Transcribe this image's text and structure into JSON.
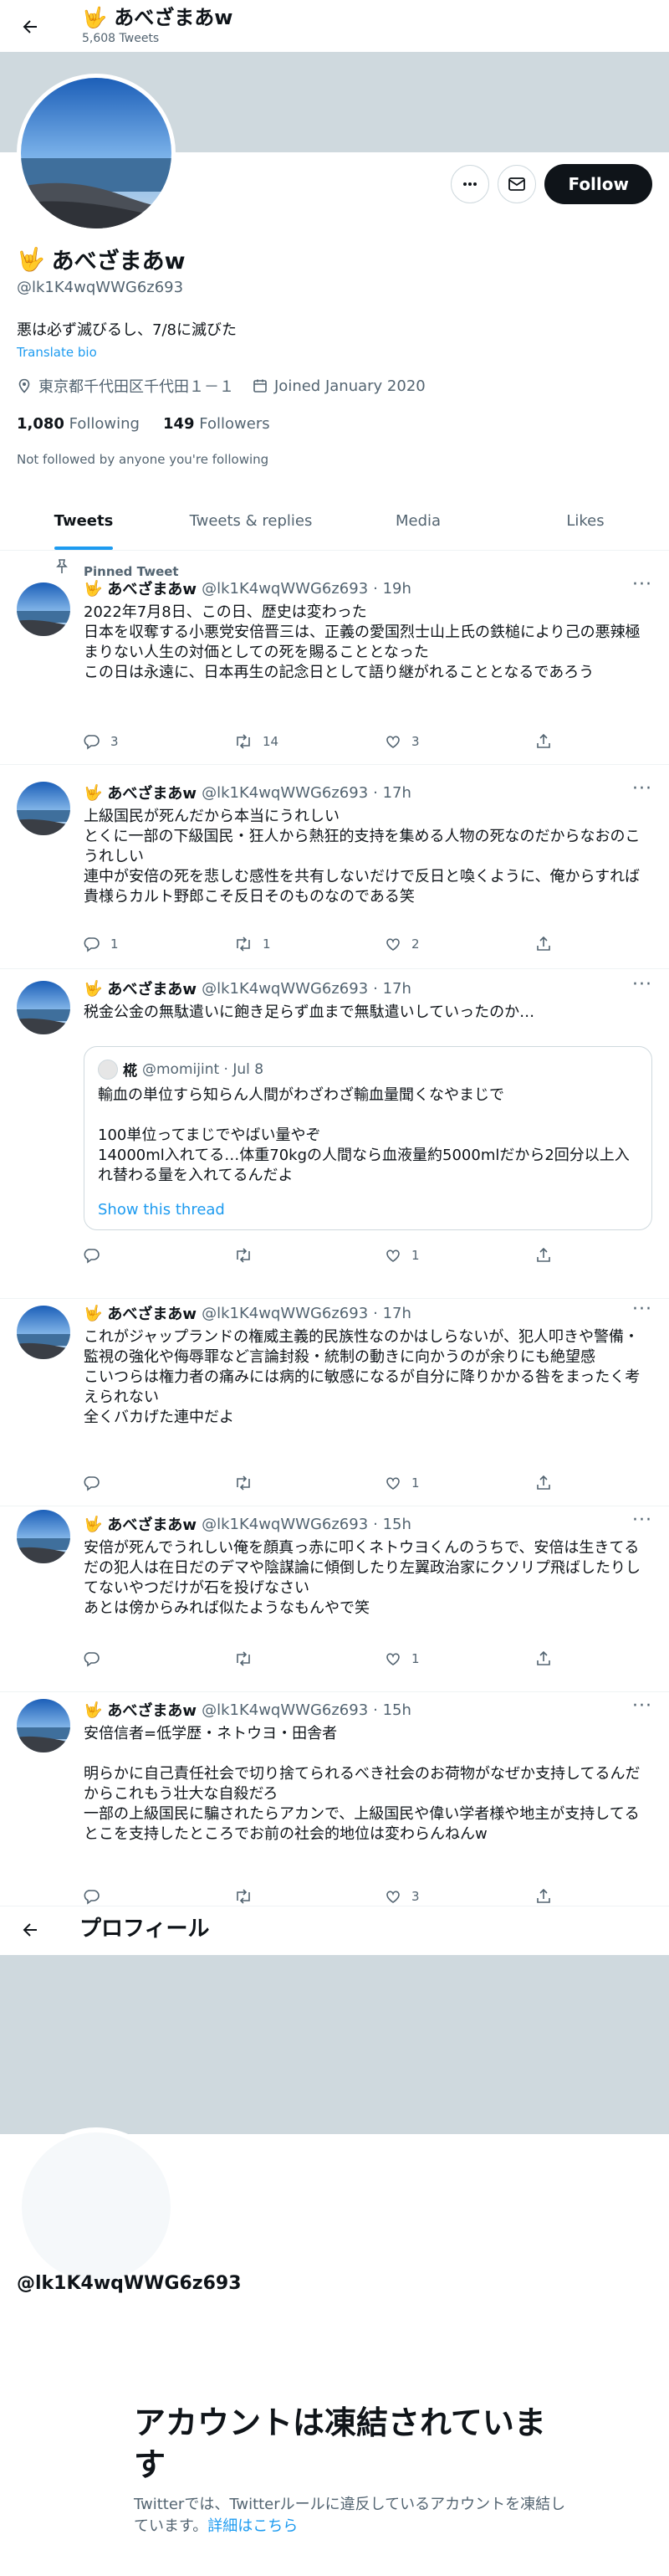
{
  "header": {
    "name": "あべざまあw",
    "tweet_count": "5,608 Tweets"
  },
  "profile": {
    "name": "あべざまあw",
    "handle": "@lk1K4wqWWG6z693",
    "bio": "悪は必ず滅びるし、7/8に滅びた",
    "translate": "Translate bio",
    "location": "東京都千代田区千代田１－１",
    "joined": "Joined January 2020",
    "following_count": "1,080",
    "following_label": "Following",
    "followers_count": "149",
    "followers_label": "Followers",
    "not_followed": "Not followed by anyone you're following",
    "follow_button": "Follow"
  },
  "tabs": [
    "Tweets",
    "Tweets & replies",
    "Media",
    "Likes"
  ],
  "pinned_label": "Pinned Tweet",
  "tweets": [
    {
      "name": "あべざまあw",
      "handle": "@lk1K4wqWWG6z693",
      "time": "· 19h",
      "text": "2022年7月8日、この日、歴史は変わった\n日本を収奪する小悪党安倍晋三は、正義の愛国烈士山上氏の鉄槌により己の悪辣極まりない人生の対価としての死を賜ることとなった\nこの日は永遠に、日本再生の記念日として語り継がれることとなるであろう",
      "replies": "3",
      "retweets": "14",
      "likes": "3"
    },
    {
      "name": "あべざまあw",
      "handle": "@lk1K4wqWWG6z693",
      "time": "· 17h",
      "text": "上級国民が死んだから本当にうれしい\nとくに一部の下級国民・狂人から熱狂的支持を集める人物の死なのだからなおのこうれしい\n連中が安倍の死を悲しむ感性を共有しないだけで反日と喚くように、俺からすれば貴様らカルト野郎こそ反日そのものなのである笑",
      "replies": "1",
      "retweets": "1",
      "likes": "2"
    },
    {
      "name": "あべざまあw",
      "handle": "@lk1K4wqWWG6z693",
      "time": "· 17h",
      "text": "税金公金の無駄遣いに飽き足らず血まで無駄遣いしていったのか…",
      "replies": "",
      "retweets": "",
      "likes": "1",
      "quote": {
        "name": "椛",
        "handle": "@momijint · Jul 8",
        "text": "輸血の単位すら知らん人間がわざわざ輸血量聞くなやまじで\n\n100単位ってまじでやばい量やぞ\n14000ml入れてる…体重70kgの人間なら血液量約5000mlだから2回分以上入れ替わる量を入れてるんだよ",
        "show_thread": "Show this thread"
      }
    },
    {
      "name": "あべざまあw",
      "handle": "@lk1K4wqWWG6z693",
      "time": "· 17h",
      "text": "これがジャップランドの権威主義的民族性なのかはしらないが、犯人叩きや警備・監視の強化や侮辱罪など言論封殺・統制の動きに向かうのが余りにも絶望感\nこいつらは権力者の痛みには病的に敏感になるが自分に降りかかる咎をまったく考えられない\n全くバカげた連中だよ",
      "replies": "",
      "retweets": "",
      "likes": "1"
    },
    {
      "name": "あべざまあw",
      "handle": "@lk1K4wqWWG6z693",
      "time": "· 15h",
      "text": "安倍が死んでうれしい俺を顔真っ赤に叩くネトウヨくんのうちで、安倍は生きてるだの犯人は在日だのデマや陰謀論に傾倒したり左翼政治家にクソリプ飛ばしたりしてないやつだけが石を投げなさい\nあとは傍からみれば似たようなもんやで笑",
      "replies": "",
      "retweets": "",
      "likes": "1"
    },
    {
      "name": "あべざまあw",
      "handle": "@lk1K4wqWWG6z693",
      "time": "· 15h",
      "text": "安倍信者=低学歴・ネトウヨ・田舎者\n\n明らかに自己責任社会で切り捨てられるべき社会のお荷物がなぜか支持してるんだからこれもう壮大な自殺だろ\n一部の上級国民に騙されたらアカンで、上級国民や偉い学者様や地主が支持してるとこを支持したところでお前の社会的地位は変わらんねんw",
      "replies": "",
      "retweets": "",
      "likes": "3"
    }
  ],
  "second": {
    "title": "プロフィール",
    "handle": "@lk1K4wqWWG6z693",
    "suspended_title": "アカウントは凍結されています",
    "suspended_desc": "Twitterでは、Twitterルールに違反しているアカウントを凍結しています。",
    "suspended_link": "詳細はこちら"
  },
  "colors": {
    "accent": "#1d9bf0",
    "banner": "#cfd9de",
    "text": "#0f1419",
    "muted": "#536471"
  }
}
